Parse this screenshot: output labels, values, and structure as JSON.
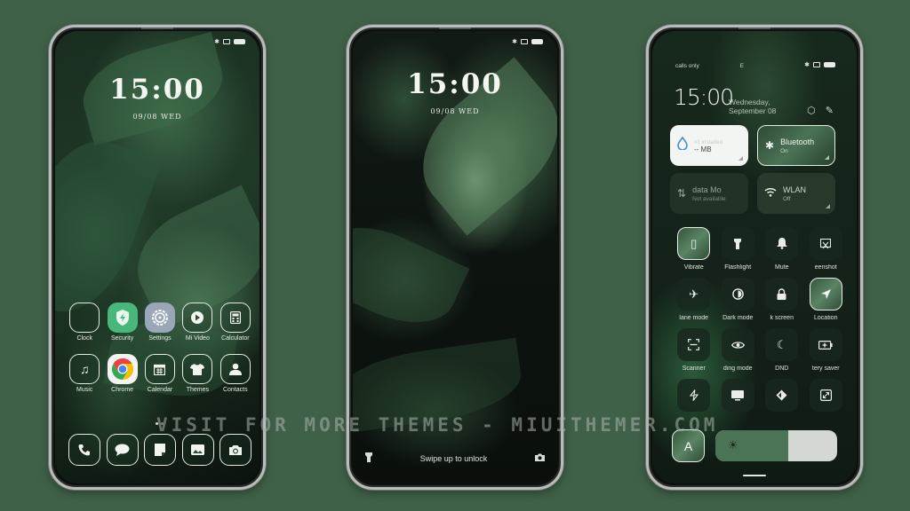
{
  "colors": {
    "background": "#3f6148",
    "security_icon": "#48b77a",
    "settings_icon": "#9aa7b8",
    "brightness_fill": "#4b7356",
    "brightness_track": "#d3d8d2"
  },
  "home_screen": {
    "status_icons": [
      "bluetooth-icon",
      "sim-icon",
      "battery-icon"
    ],
    "clock": "15:00",
    "date": "09/08 WED",
    "apps": [
      {
        "label": "Clock",
        "icon": "clock-icon"
      },
      {
        "label": "Security",
        "icon": "shield-bolt-icon"
      },
      {
        "label": "Settings",
        "icon": "gear-icon"
      },
      {
        "label": "Mi Video",
        "icon": "play-icon"
      },
      {
        "label": "Calculator",
        "icon": "calculator-icon"
      },
      {
        "label": "Music",
        "icon": "music-note-icon"
      },
      {
        "label": "Chrome",
        "icon": "chrome-icon"
      },
      {
        "label": "Calendar",
        "icon": "calendar-icon"
      },
      {
        "label": "Themes",
        "icon": "tshirt-icon"
      },
      {
        "label": "Contacts",
        "icon": "person-icon"
      }
    ],
    "dock": [
      {
        "icon": "phone-icon"
      },
      {
        "icon": "message-icon"
      },
      {
        "icon": "notes-icon"
      },
      {
        "icon": "gallery-icon"
      },
      {
        "icon": "camera-icon"
      }
    ]
  },
  "lock_screen": {
    "clock": "15:00",
    "date": "09/08 WED",
    "unlock_hint": "Swipe up to unlock"
  },
  "control_center": {
    "carrier": "calls only",
    "network": "E",
    "time": "15:00",
    "date_line1": "Wednesday,",
    "date_line2": "September 08",
    "tiles": [
      {
        "title": "n't installed",
        "subtitle": "-- MB",
        "icon": "water-drop-icon"
      },
      {
        "title": "Bluetooth",
        "subtitle": "On",
        "icon": "bluetooth-icon"
      },
      {
        "title": "data    Mo",
        "subtitle": "Not available",
        "icon": "data-arrows-icon"
      },
      {
        "title": "WLAN",
        "subtitle": "Off",
        "icon": "wifi-icon"
      }
    ],
    "toggles": [
      {
        "label": "Vibrate",
        "icon": "vibrate-icon",
        "active": true
      },
      {
        "label": "Flashlight",
        "icon": "flashlight-icon",
        "active": false
      },
      {
        "label": "Mute",
        "icon": "bell-icon",
        "active": false
      },
      {
        "label": "eenshot",
        "icon": "screenshot-icon",
        "active": false
      },
      {
        "label": "lane mode",
        "icon": "airplane-icon",
        "active": false
      },
      {
        "label": "Dark mode",
        "icon": "dark-mode-icon",
        "active": false
      },
      {
        "label": "k screen",
        "icon": "lock-icon",
        "active": false
      },
      {
        "label": "Location",
        "icon": "location-icon",
        "active": true
      },
      {
        "label": "Scanner",
        "icon": "scanner-icon",
        "active": false
      },
      {
        "label": "ding mode",
        "icon": "eye-icon",
        "active": false
      },
      {
        "label": "DND",
        "icon": "moon-icon",
        "active": false
      },
      {
        "label": "tery saver",
        "icon": "battery-saver-icon",
        "active": false
      },
      {
        "label": "",
        "icon": "bolt-icon",
        "active": false
      },
      {
        "label": "",
        "icon": "cast-icon",
        "active": false
      },
      {
        "label": "",
        "icon": "mi-share-icon",
        "active": false
      },
      {
        "label": "",
        "icon": "resize-icon",
        "active": false
      }
    ],
    "auto_brightness_label": "A",
    "brightness_percent": 60
  },
  "watermark": "VISIT FOR MORE THEMES - MIUITHEMER.COM"
}
